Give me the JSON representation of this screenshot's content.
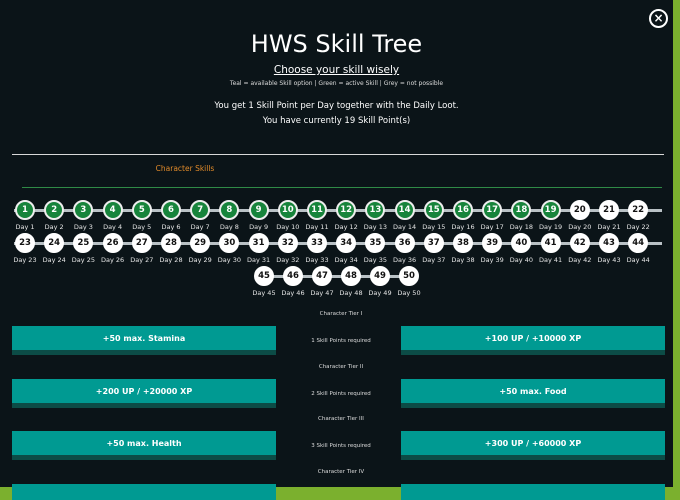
{
  "close_symbol": "×",
  "header": {
    "title": "HWS Skill Tree",
    "subtitle": "Choose your skill wisely",
    "legend": "Teal = available Skill option | Green = active Skill | Grey = not possible",
    "info_line1": "You get 1 Skill Point per Day together with the Daily Loot.",
    "info_line2": "You have currently 19 Skill Point(s)"
  },
  "section": {
    "title": "Character Skills"
  },
  "days": [
    {
      "n": "1",
      "label": "Day 1",
      "state": "active"
    },
    {
      "n": "2",
      "label": "Day 2",
      "state": "active"
    },
    {
      "n": "3",
      "label": "Day 3",
      "state": "active"
    },
    {
      "n": "4",
      "label": "Day 4",
      "state": "active"
    },
    {
      "n": "5",
      "label": "Day 5",
      "state": "active"
    },
    {
      "n": "6",
      "label": "Day 6",
      "state": "active"
    },
    {
      "n": "7",
      "label": "Day 7",
      "state": "active"
    },
    {
      "n": "8",
      "label": "Day 8",
      "state": "active"
    },
    {
      "n": "9",
      "label": "Day 9",
      "state": "active"
    },
    {
      "n": "10",
      "label": "Day 10",
      "state": "active"
    },
    {
      "n": "11",
      "label": "Day 11",
      "state": "active"
    },
    {
      "n": "12",
      "label": "Day 12",
      "state": "active"
    },
    {
      "n": "13",
      "label": "Day 13",
      "state": "active"
    },
    {
      "n": "14",
      "label": "Day 14",
      "state": "active"
    },
    {
      "n": "15",
      "label": "Day 15",
      "state": "active"
    },
    {
      "n": "16",
      "label": "Day 16",
      "state": "active"
    },
    {
      "n": "17",
      "label": "Day 17",
      "state": "active"
    },
    {
      "n": "18",
      "label": "Day 18",
      "state": "active"
    },
    {
      "n": "19",
      "label": "Day 19",
      "state": "active"
    },
    {
      "n": "20",
      "label": "Day 20",
      "state": "available"
    },
    {
      "n": "21",
      "label": "Day 21",
      "state": "available"
    },
    {
      "n": "22",
      "label": "Day 22",
      "state": "available"
    },
    {
      "n": "23",
      "label": "Day 23",
      "state": "available"
    },
    {
      "n": "24",
      "label": "Day 24",
      "state": "available"
    },
    {
      "n": "25",
      "label": "Day 25",
      "state": "available"
    },
    {
      "n": "26",
      "label": "Day 26",
      "state": "available"
    },
    {
      "n": "27",
      "label": "Day 27",
      "state": "available"
    },
    {
      "n": "28",
      "label": "Day 28",
      "state": "available"
    },
    {
      "n": "29",
      "label": "Day 29",
      "state": "available"
    },
    {
      "n": "30",
      "label": "Day 30",
      "state": "available"
    },
    {
      "n": "31",
      "label": "Day 31",
      "state": "available"
    },
    {
      "n": "32",
      "label": "Day 32",
      "state": "available"
    },
    {
      "n": "33",
      "label": "Day 33",
      "state": "available"
    },
    {
      "n": "34",
      "label": "Day 34",
      "state": "available"
    },
    {
      "n": "35",
      "label": "Day 35",
      "state": "available"
    },
    {
      "n": "36",
      "label": "Day 36",
      "state": "available"
    },
    {
      "n": "37",
      "label": "Day 37",
      "state": "available"
    },
    {
      "n": "38",
      "label": "Day 38",
      "state": "available"
    },
    {
      "n": "39",
      "label": "Day 39",
      "state": "available"
    },
    {
      "n": "40",
      "label": "Day 40",
      "state": "available"
    },
    {
      "n": "41",
      "label": "Day 41",
      "state": "available"
    },
    {
      "n": "42",
      "label": "Day 42",
      "state": "available"
    },
    {
      "n": "43",
      "label": "Day 43",
      "state": "available"
    },
    {
      "n": "44",
      "label": "Day 44",
      "state": "available"
    },
    {
      "n": "45",
      "label": "Day 45",
      "state": "available"
    },
    {
      "n": "46",
      "label": "Day 46",
      "state": "available"
    },
    {
      "n": "47",
      "label": "Day 47",
      "state": "available"
    },
    {
      "n": "48",
      "label": "Day 48",
      "state": "available"
    },
    {
      "n": "49",
      "label": "Day 49",
      "state": "available"
    },
    {
      "n": "50",
      "label": "Day 50",
      "state": "available"
    }
  ],
  "tiers": [
    {
      "title": "Character Tier I",
      "requirement": "1 Skill Points required",
      "left": "+50 max. Stamina",
      "right": "+100 UP / +10000 XP"
    },
    {
      "title": "Character Tier II",
      "requirement": "2 Skill Points required",
      "left": "+200 UP / +20000 XP",
      "right": "+50 max. Food"
    },
    {
      "title": "Character Tier III",
      "requirement": "3 Skill Points required",
      "left": "+50 max. Health",
      "right": "+300 UP / +60000 XP"
    },
    {
      "title": "Character Tier IV",
      "requirement": "",
      "left": "",
      "right": ""
    }
  ],
  "colors": {
    "background": "#0b1418",
    "active_green": "#17843b",
    "teal_button": "#009a92",
    "section_orange": "#e08a2a",
    "frame_green": "#7bb02e"
  }
}
